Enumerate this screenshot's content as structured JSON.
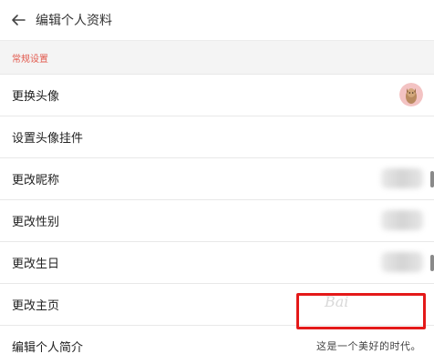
{
  "header": {
    "title": "编辑个人资料"
  },
  "section": {
    "title": "常规设置"
  },
  "rows": [
    {
      "label": "更换头像"
    },
    {
      "label": "设置头像挂件"
    },
    {
      "label": "更改昵称"
    },
    {
      "label": "更改性别"
    },
    {
      "label": "更改生日"
    },
    {
      "label": "更改主页"
    },
    {
      "label": "编辑个人简介",
      "value": "这是一个美好的时代。"
    }
  ],
  "watermark": "Bai"
}
